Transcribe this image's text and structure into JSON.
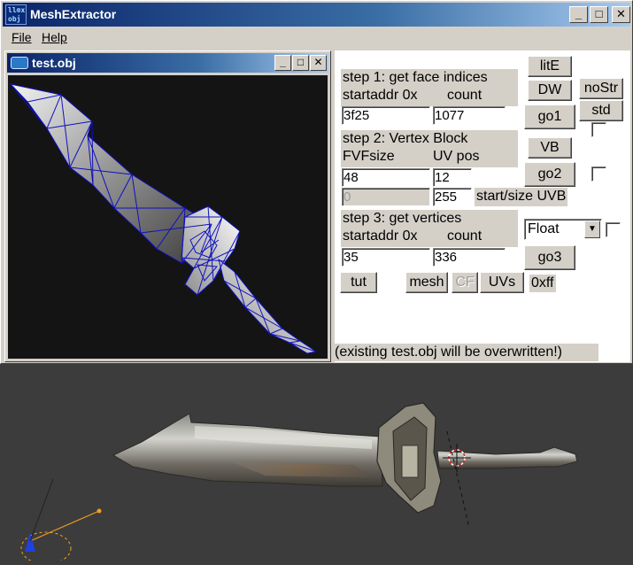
{
  "window": {
    "title": "MeshExtractor",
    "icon_line1": "ll⊗x",
    "icon_line2": "obj",
    "minimize": "_",
    "maximize": "□",
    "close": "✕"
  },
  "menu": {
    "file": "File",
    "help": "Help"
  },
  "child": {
    "title": "test.obj",
    "minimize": "_",
    "maximize": "□",
    "close": "✕"
  },
  "panel": {
    "step1": {
      "label": "step 1: get face indices",
      "startaddr_label": "startaddr 0x",
      "count_label": "count",
      "startaddr_value": "3f25",
      "count_value": "1077"
    },
    "step2": {
      "label": "step 2: Vertex Block",
      "fvf_label": "FVFsize",
      "uvpos_label": "UV pos",
      "fvf_value": "48",
      "uvpos_value": "12",
      "uvb_start_value": "0",
      "uvb_size_value": "255",
      "uvb_label": "start/size UVB"
    },
    "step3": {
      "label": "step 3: get vertices",
      "startaddr_label": "startaddr 0x",
      "count_label": "count",
      "startaddr_value": "35",
      "count_value": "336"
    },
    "buttons": {
      "lite": "litE",
      "dw": "DW",
      "nostr": "noStr",
      "go1": "go1",
      "std": "std",
      "vb": "VB",
      "go2": "go2",
      "go3": "go3",
      "tut": "tut",
      "mesh": "mesh",
      "cf": "CF",
      "uvs": "UVs"
    },
    "format_select": "Float",
    "hex_label": "0xff",
    "warning": "(existing test.obj will be overwritten!)"
  },
  "colors": {
    "titlebar_start": "#0a246a",
    "titlebar_end": "#a6caf0",
    "face": "#d4d0c8",
    "wireframe": "#1010c0",
    "scene_bg": "#3c3c3c"
  }
}
